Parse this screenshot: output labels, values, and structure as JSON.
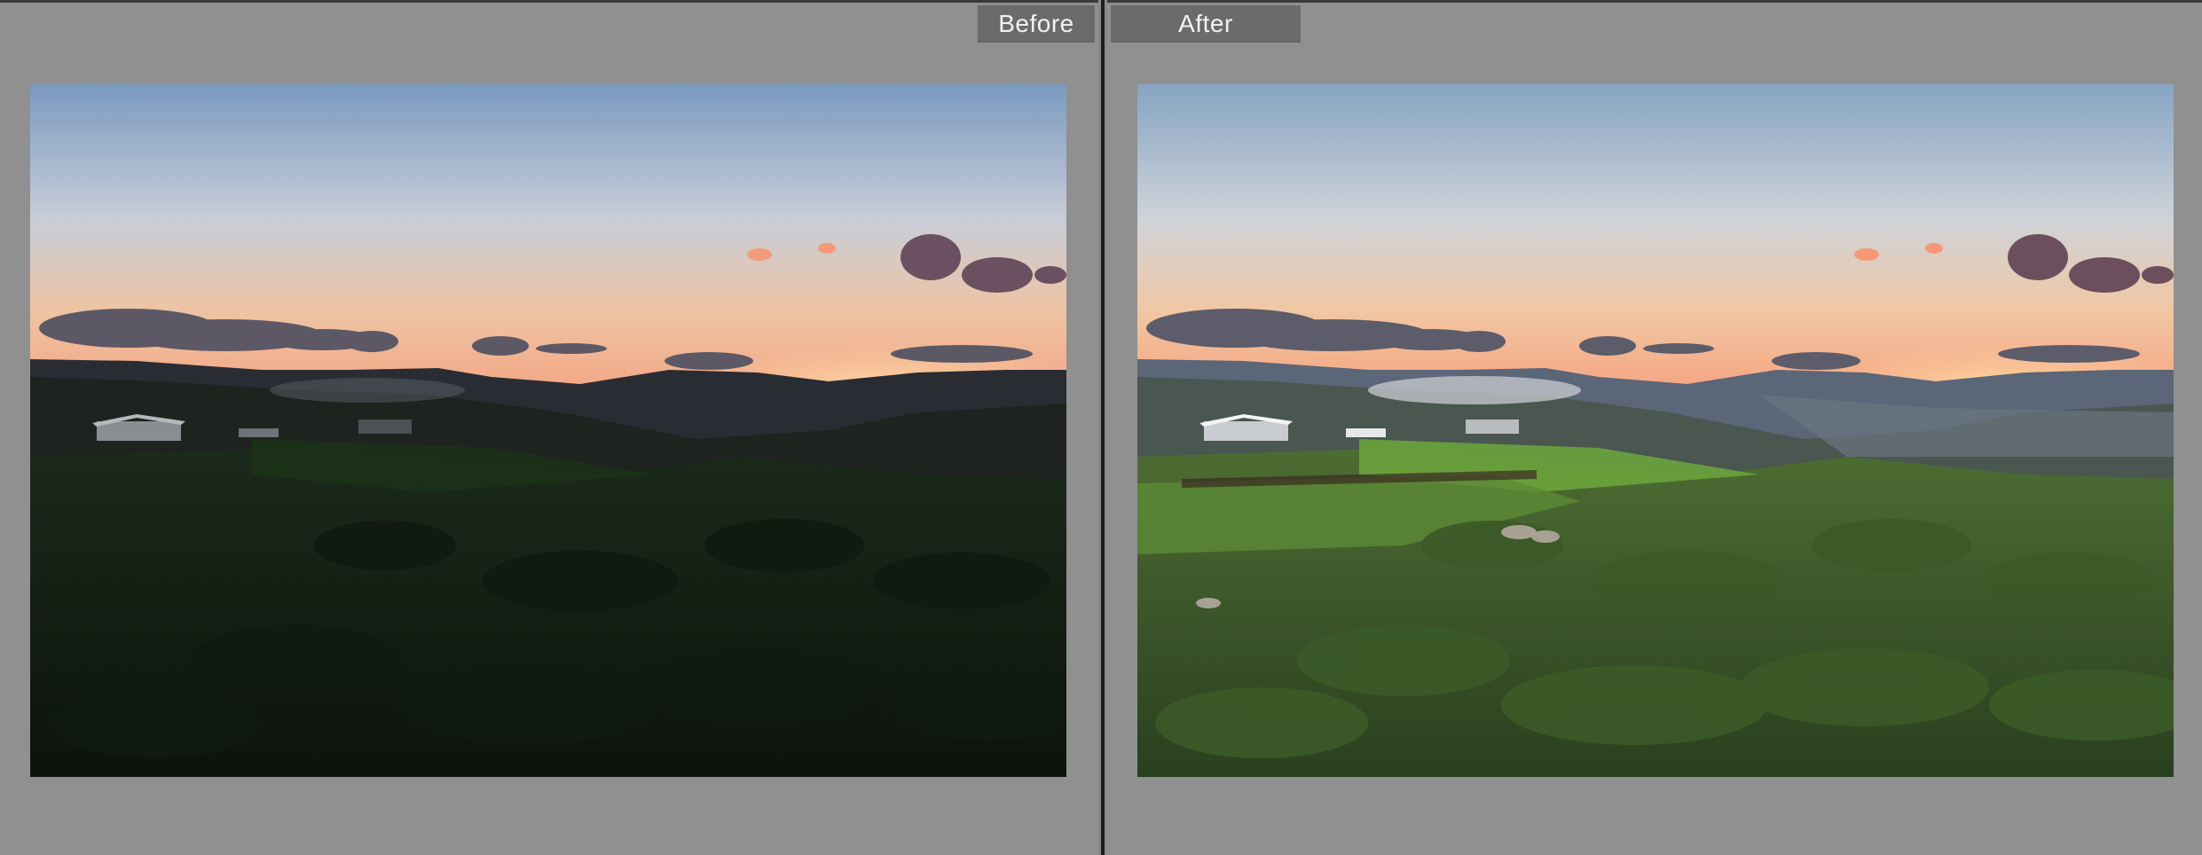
{
  "compare_view": {
    "before_label": "Before",
    "after_label": "After"
  },
  "colors": {
    "background": "#909090",
    "label_bg": "#6b6b6b",
    "divider": "#1e1e1e"
  }
}
